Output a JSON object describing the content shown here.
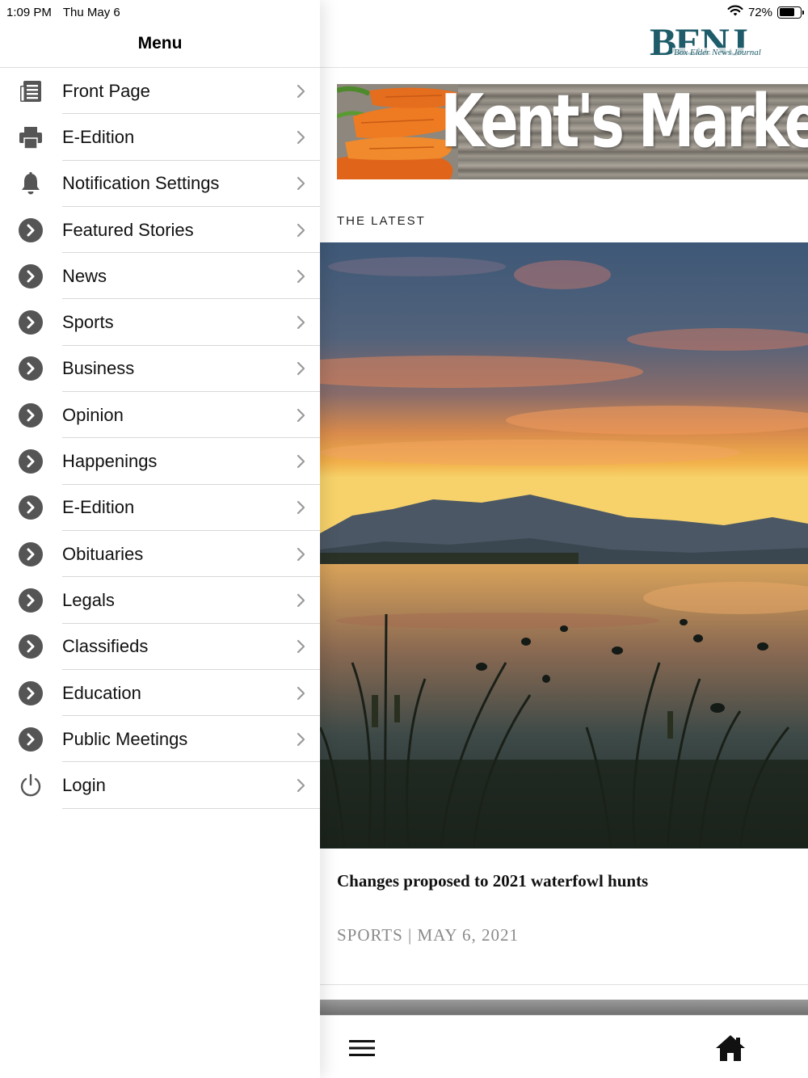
{
  "status_bar": {
    "time": "1:09 PM",
    "date": "Thu May 6",
    "battery_text": "72%",
    "battery_level": 0.72
  },
  "menu": {
    "title": "Menu",
    "items": [
      {
        "label": "Front Page",
        "icon": "newspaper-icon"
      },
      {
        "label": "E-Edition",
        "icon": "printer-icon"
      },
      {
        "label": "Notification Settings",
        "icon": "bell-icon"
      },
      {
        "label": "Featured Stories",
        "icon": "chevron-circle-icon"
      },
      {
        "label": "News",
        "icon": "chevron-circle-icon"
      },
      {
        "label": "Sports",
        "icon": "chevron-circle-icon"
      },
      {
        "label": "Business",
        "icon": "chevron-circle-icon"
      },
      {
        "label": "Opinion",
        "icon": "chevron-circle-icon"
      },
      {
        "label": "Happenings",
        "icon": "chevron-circle-icon"
      },
      {
        "label": "E-Edition",
        "icon": "chevron-circle-icon"
      },
      {
        "label": "Obituaries",
        "icon": "chevron-circle-icon"
      },
      {
        "label": "Legals",
        "icon": "chevron-circle-icon"
      },
      {
        "label": "Classifieds",
        "icon": "chevron-circle-icon"
      },
      {
        "label": "Education",
        "icon": "chevron-circle-icon"
      },
      {
        "label": "Public Meetings",
        "icon": "chevron-circle-icon"
      },
      {
        "label": "Login",
        "icon": "power-icon"
      }
    ]
  },
  "header": {
    "logo_letters": "BENJ",
    "logo_subtitle": "Box Elder News Journal",
    "brand_color": "#1f5c6a"
  },
  "banner_ad": {
    "text": "Kent's Marke"
  },
  "main": {
    "section_label": "THE LATEST",
    "story": {
      "title": "Changes proposed to 2021 waterfowl hunts",
      "meta": "SPORTS | MAY 6, 2021"
    }
  },
  "tab_bar": {
    "items": [
      {
        "icon": "hamburger-icon"
      },
      {
        "icon": "home-icon"
      }
    ]
  }
}
